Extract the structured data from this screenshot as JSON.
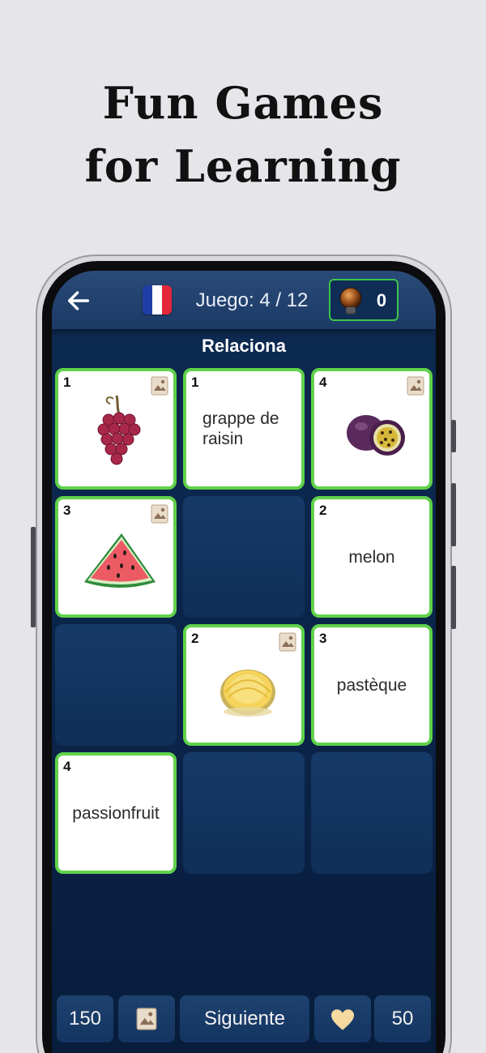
{
  "promo": {
    "line1": "Fun Games",
    "line2": "for Learning"
  },
  "header": {
    "counter": "Juego: 4 / 12",
    "hint_count": "0",
    "flag_colors": [
      "#1f3ea6",
      "#ffffff",
      "#e2283a"
    ]
  },
  "section_title": "Relaciona",
  "cards": [
    {
      "number": "1",
      "type": "image",
      "image": "grapes",
      "has_album_icon": true
    },
    {
      "number": "1",
      "type": "word",
      "word": "grappe de raisin"
    },
    {
      "number": "4",
      "type": "image",
      "image": "passionfruit",
      "has_album_icon": true
    },
    {
      "number": "3",
      "type": "image",
      "image": "watermelon",
      "has_album_icon": true
    },
    {
      "type": "empty"
    },
    {
      "number": "2",
      "type": "word",
      "word": "melon"
    },
    {
      "type": "empty"
    },
    {
      "number": "2",
      "type": "image",
      "image": "melon",
      "has_album_icon": true
    },
    {
      "number": "3",
      "type": "word",
      "word": "pastèque"
    },
    {
      "number": "4",
      "type": "word",
      "word": "passionfruit"
    },
    {
      "type": "empty"
    },
    {
      "type": "empty"
    }
  ],
  "bottom": {
    "coins": "150",
    "next_label": "Siguiente",
    "lives": "50"
  },
  "colors": {
    "accent_green": "#5fd24a",
    "panel_blue": "#0d2a52"
  }
}
